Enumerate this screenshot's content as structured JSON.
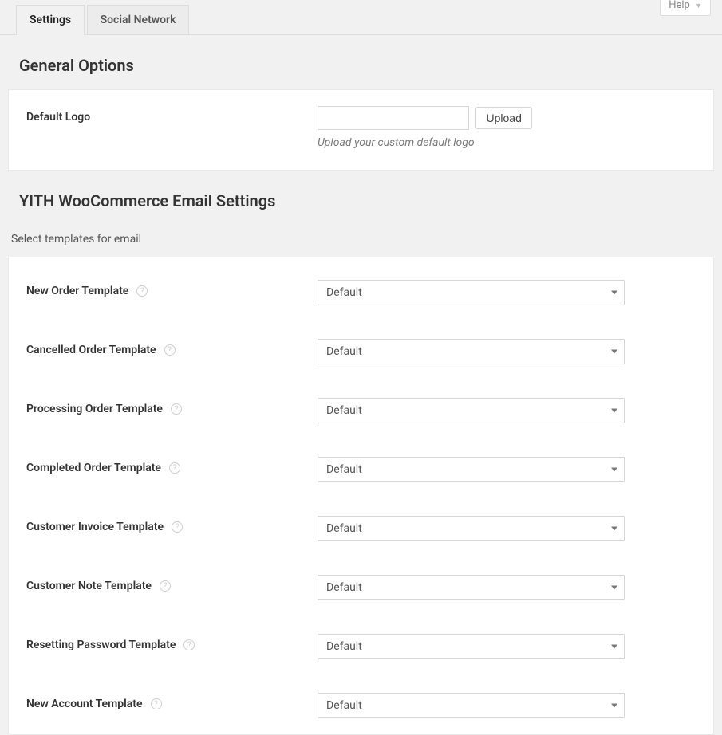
{
  "topbar": {
    "help_label": "Help"
  },
  "tabs": {
    "settings": "Settings",
    "social_network": "Social Network"
  },
  "general": {
    "heading": "General Options",
    "default_logo_label": "Default Logo",
    "upload_button": "Upload",
    "upload_hint": "Upload your custom default logo"
  },
  "email": {
    "heading": "YITH WooCommerce Email Settings",
    "subtext": "Select templates for email",
    "rows": [
      {
        "label": "New Order Template",
        "value": "Default"
      },
      {
        "label": "Cancelled Order Template",
        "value": "Default"
      },
      {
        "label": "Processing Order Template",
        "value": "Default"
      },
      {
        "label": "Completed Order Template",
        "value": "Default"
      },
      {
        "label": "Customer Invoice Template",
        "value": "Default"
      },
      {
        "label": "Customer Note Template",
        "value": "Default"
      },
      {
        "label": "Resetting Password Template",
        "value": "Default"
      },
      {
        "label": "New Account Template",
        "value": "Default"
      }
    ]
  }
}
